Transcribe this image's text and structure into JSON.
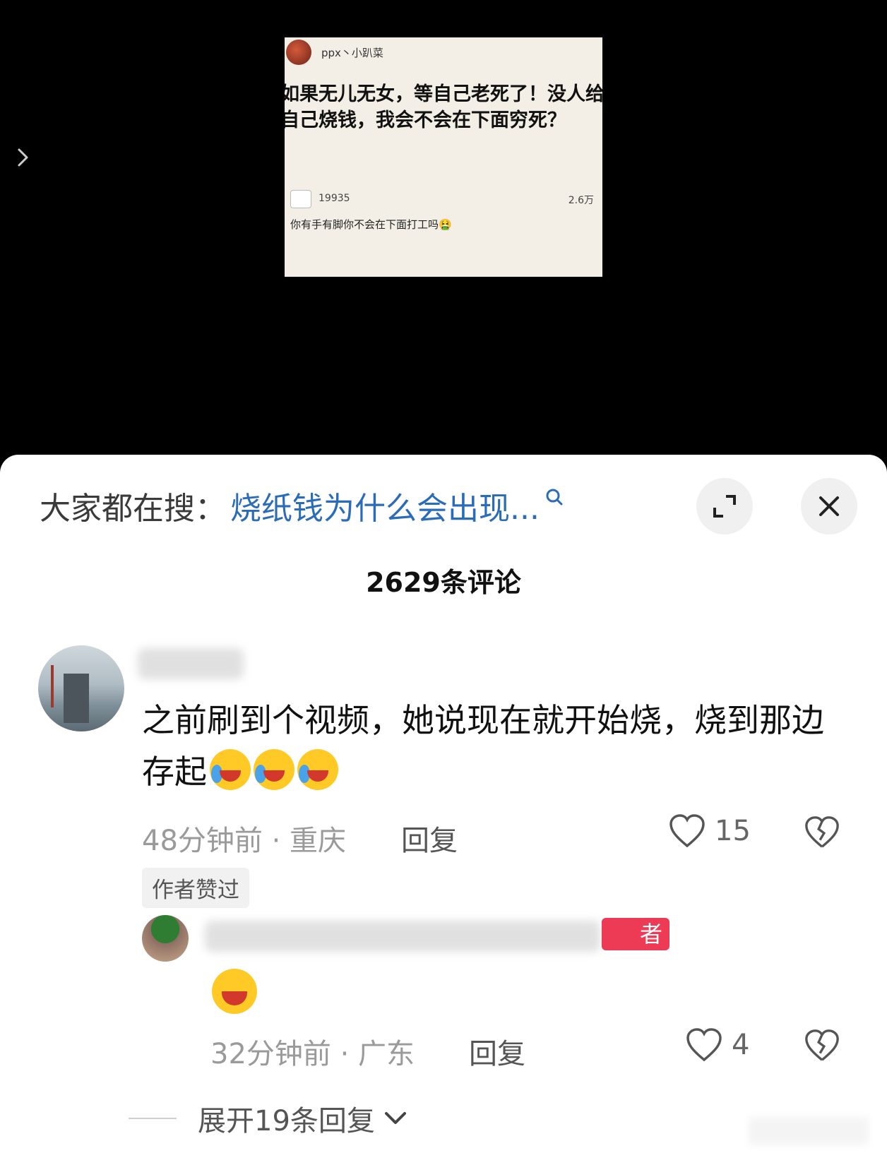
{
  "post_card": {
    "username": "ppx丶小趴菜",
    "question": "如果无儿无女，等自己老死了！没人给自己烧钱，我会不会在下面穷死？",
    "answer_user": "19935",
    "answer_likes": "2.6万",
    "answer_text": "你有手有脚你不会在下面打工吗🤮"
  },
  "header": {
    "search_label": "大家都在搜：",
    "search_link": "烧纸钱为什么会出现...",
    "comment_count": "2629条评论"
  },
  "comments": [
    {
      "text": "之前刷到个视频，她说现在就开始烧，烧到那边存起",
      "time_location": "48分钟前 · 重庆",
      "reply_label": "回复",
      "likes": "15",
      "badge": "作者赞过"
    },
    {
      "author_tag": "者",
      "time_location": "32分钟前 · 广东",
      "reply_label": "回复",
      "likes": "4"
    }
  ],
  "expand_replies": "展开19条回复",
  "icons": {
    "side": "chevron-right-icon",
    "search": "search-icon",
    "expand": "expand-icon",
    "close": "close-icon",
    "like": "heart-icon",
    "dislike": "broken-heart-icon",
    "chevron": "chevron-down-icon"
  },
  "colors": {
    "link": "#2b6cb6",
    "author_tag": "#ee3b55",
    "background_top": "#000000",
    "sheet": "#ffffff"
  }
}
